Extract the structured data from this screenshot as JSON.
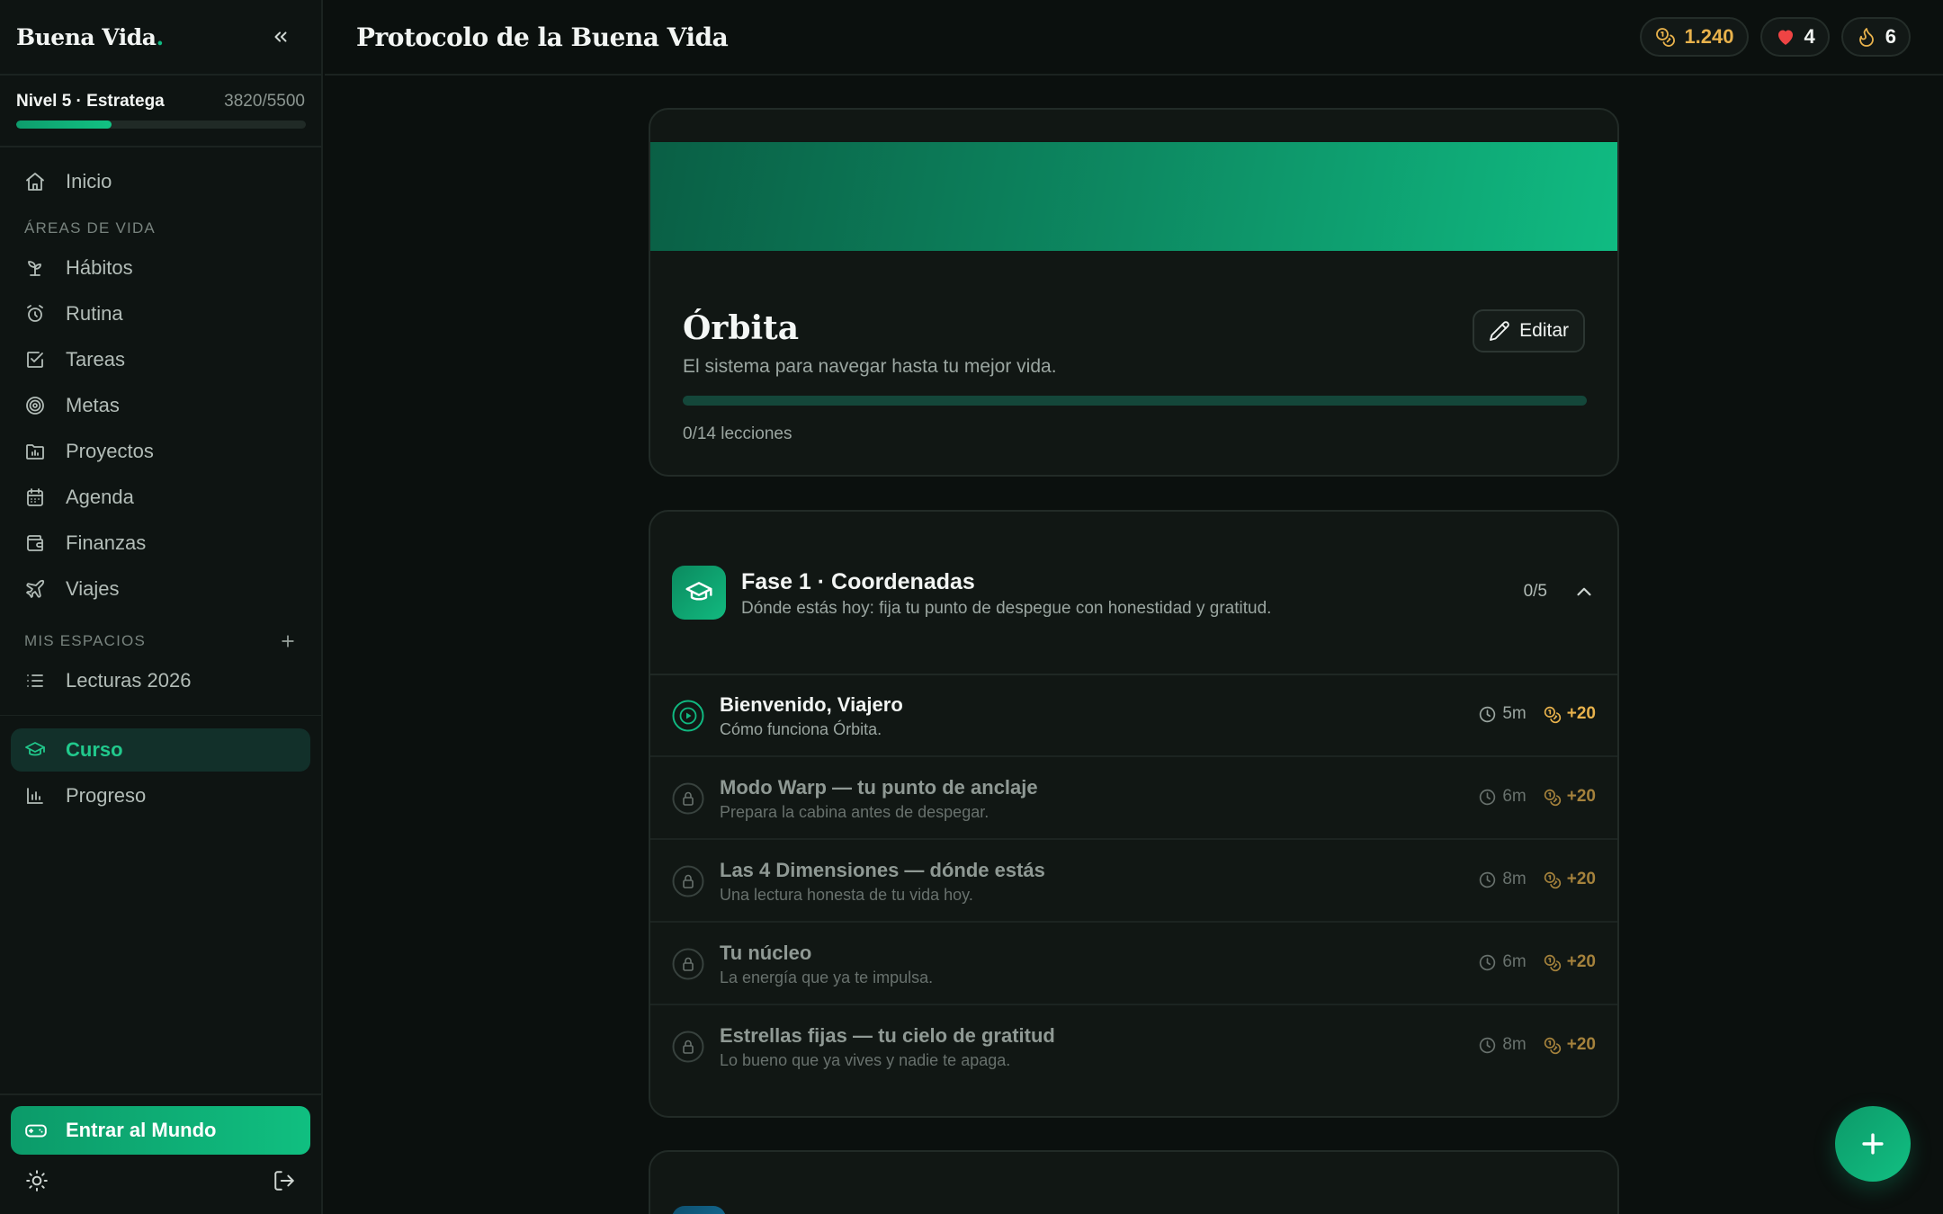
{
  "sidebar": {
    "brand": "Buena Vida",
    "brand_dot": ".",
    "level": {
      "label": "Nivel 5 · Estratega",
      "xp": "3820/5500",
      "progress": 0.33
    },
    "nav_top": [
      {
        "label": "Inicio",
        "icon": "home-icon"
      }
    ],
    "areas_label": "ÁREAS DE VIDA",
    "areas": [
      {
        "label": "Hábitos",
        "icon": "sprout-icon"
      },
      {
        "label": "Rutina",
        "icon": "alarm-clock-icon"
      },
      {
        "label": "Tareas",
        "icon": "checkbox-icon"
      },
      {
        "label": "Metas",
        "icon": "target-icon"
      },
      {
        "label": "Proyectos",
        "icon": "folder-chart-icon"
      },
      {
        "label": "Agenda",
        "icon": "calendar-icon"
      },
      {
        "label": "Finanzas",
        "icon": "wallet-icon"
      },
      {
        "label": "Viajes",
        "icon": "plane-icon"
      }
    ],
    "spaces_label": "MIS ESPACIOS",
    "spaces": [
      {
        "label": "Lecturas 2026",
        "icon": "list-icon"
      }
    ],
    "bottom_nav": [
      {
        "label": "Curso",
        "icon": "graduation-cap-icon",
        "active": true
      },
      {
        "label": "Progreso",
        "icon": "bar-chart-icon",
        "active": false
      }
    ],
    "world_button": "Entrar al Mundo"
  },
  "header": {
    "title": "Protocolo de la Buena Vida",
    "coins": "1.240",
    "hearts": "4",
    "streak": "6"
  },
  "course": {
    "title": "Órbita",
    "subtitle": "El sistema para navegar hasta tu mejor vida.",
    "edit_label": "Editar",
    "progress": 0,
    "count_label": "0/14 lecciones"
  },
  "phase": {
    "title": "Fase 1 · Coordenadas",
    "description": "Dónde estás hoy: fija tu punto de despegue con honestidad y gratitud.",
    "count": "0/5",
    "lessons": [
      {
        "title": "Bienvenido, Viajero",
        "description": "Cómo funciona Órbita.",
        "duration": "5m",
        "xp": "+20",
        "status": "available"
      },
      {
        "title": "Modo Warp — tu punto de anclaje",
        "description": "Prepara la cabina antes de despegar.",
        "duration": "6m",
        "xp": "+20",
        "status": "locked"
      },
      {
        "title": "Las 4 Dimensiones — dónde estás",
        "description": "Una lectura honesta de tu vida hoy.",
        "duration": "8m",
        "xp": "+20",
        "status": "locked"
      },
      {
        "title": "Tu núcleo",
        "description": "La energía que ya te impulsa.",
        "duration": "6m",
        "xp": "+20",
        "status": "locked"
      },
      {
        "title": "Estrellas fijas — tu cielo de gratitud",
        "description": "Lo bueno que ya vives y nadie te apaga.",
        "duration": "8m",
        "xp": "+20",
        "status": "locked"
      }
    ]
  },
  "colors": {
    "accent": "#10b981",
    "coin": "#e8b24c",
    "heart": "#ef4444",
    "background": "#0b100e"
  }
}
